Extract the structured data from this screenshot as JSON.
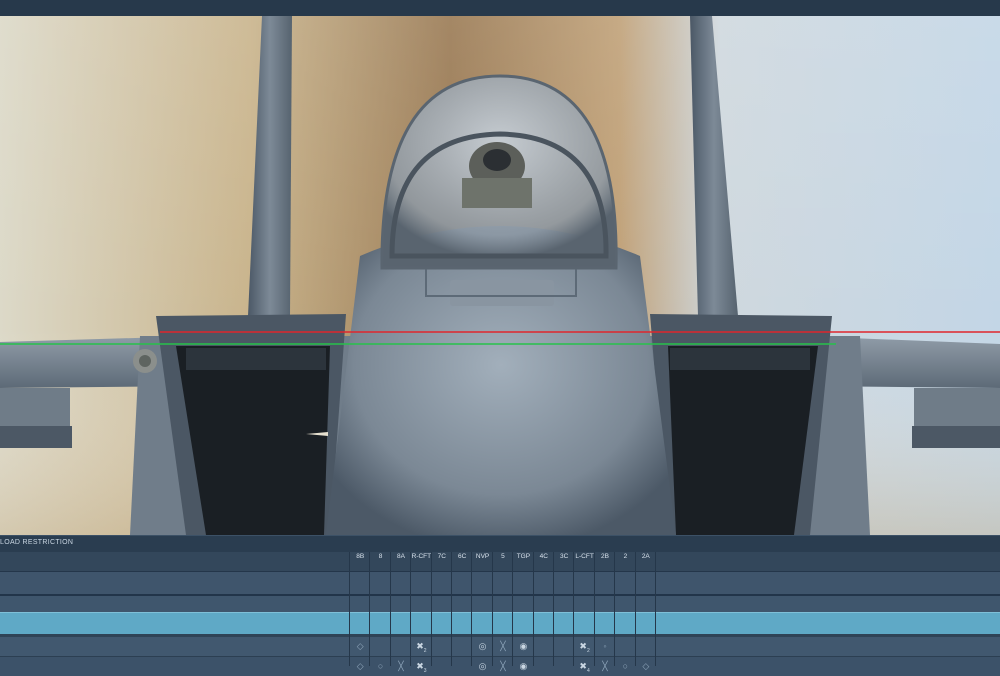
{
  "panel": {
    "title": "LOAD RESTRICTION",
    "stations": [
      "8B",
      "8",
      "8A",
      "R-CFT",
      "7C",
      "6C",
      "NVP",
      "5",
      "TGP",
      "4C",
      "3C",
      "L-CFT",
      "2B",
      "2",
      "2A"
    ]
  },
  "rows": [
    {
      "name": "row-1",
      "cells": {
        "8B": "◇",
        "R-CFT": "✖",
        "NVP": "◎",
        "5": "╳",
        "TGP": "◉",
        "L-CFT": "✖",
        "2B": "◦"
      },
      "subs": {
        "R-CFT": "2",
        "L-CFT": "2"
      }
    },
    {
      "name": "row-2",
      "cells": {
        "8B": "◇",
        "8": "○",
        "8A": "╳",
        "R-CFT": "✖",
        "NVP": "◎",
        "5": "╳",
        "TGP": "◉",
        "L-CFT": "✖",
        "2B": "╳",
        "2": "○",
        "2A": "◇"
      },
      "subs": {
        "R-CFT": "3",
        "L-CFT": "4"
      }
    }
  ],
  "colors": {
    "accent_row": "#5fa9c6",
    "line_red": "#e0262d",
    "line_green": "#27c24b"
  },
  "icons": {
    "pylon_marker": "diamond-icon",
    "bomb_cluster": "bomb-cluster-icon",
    "pod": "pod-icon",
    "targeting_pod": "targeting-pod-icon",
    "empty": "cross-icon",
    "tank": "tank-icon"
  }
}
